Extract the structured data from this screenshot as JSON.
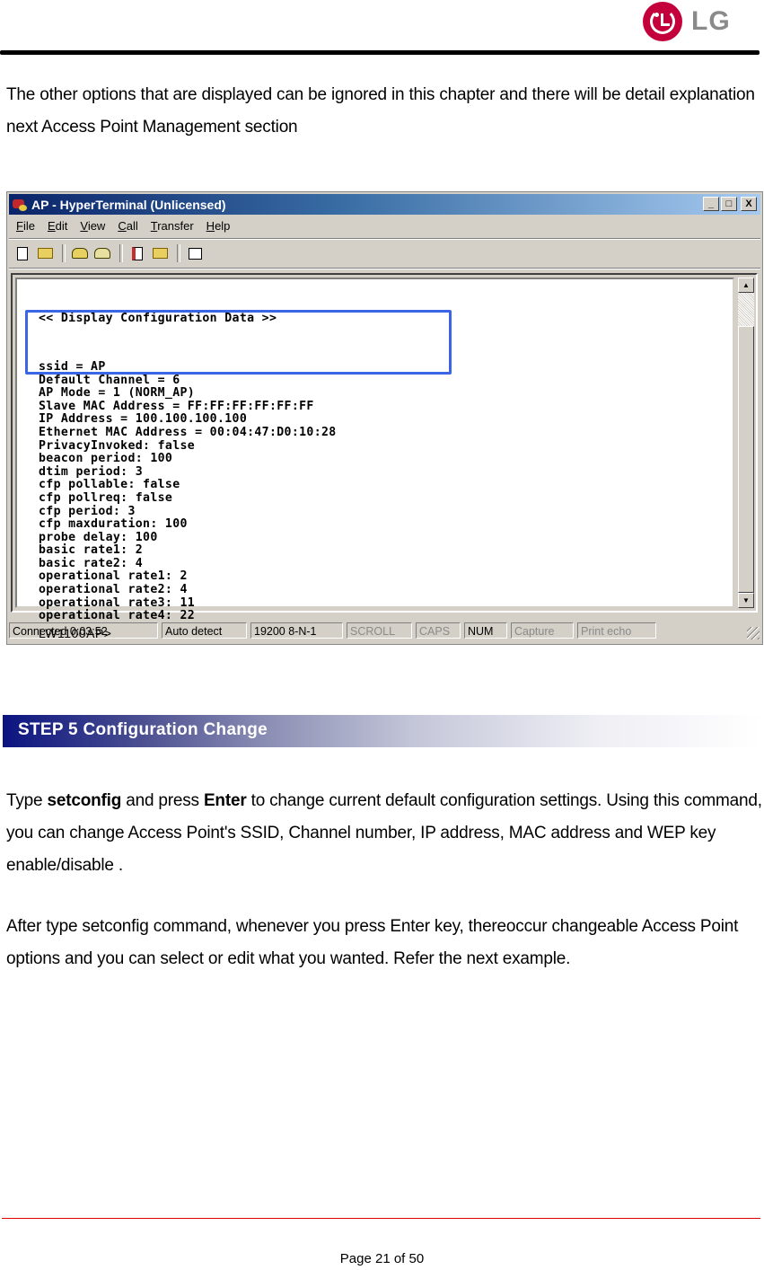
{
  "header": {
    "logo_text": "LG"
  },
  "intro": {
    "text": "The other options that are displayed can be ignored in this chapter and there will be detail explanation next Access Point Management section"
  },
  "window": {
    "title": "AP - HyperTerminal (Unlicensed)",
    "title_buttons": {
      "minimize": "_",
      "maximize": "□",
      "close": "X"
    },
    "menu": [
      {
        "key": "F",
        "rest": "ile"
      },
      {
        "key": "E",
        "rest": "dit"
      },
      {
        "key": "V",
        "rest": "iew"
      },
      {
        "key": "C",
        "rest": "all"
      },
      {
        "key": "T",
        "rest": "ransfer"
      },
      {
        "key": "H",
        "rest": "elp"
      }
    ],
    "toolbar": [
      "new-icon",
      "open-icon",
      "connect-icon",
      "disconnect-icon",
      "send-icon",
      "receive-icon",
      "properties-icon"
    ],
    "terminal": {
      "header": "<< Display Configuration Data >>",
      "lines": [
        "ssid = AP",
        "Default Channel = 6",
        "AP Mode = 1 (NORM_AP)",
        "Slave MAC Address = FF:FF:FF:FF:FF:FF",
        "IP Address = 100.100.100.100",
        "Ethernet MAC Address = 00:04:47:D0:10:28",
        "PrivacyInvoked: false",
        "beacon period: 100",
        "dtim period: 3",
        "cfp pollable: false",
        "cfp pollreq: false",
        "cfp period: 3",
        "cfp maxduration: 100",
        "probe delay: 100",
        "basic rate1: 2",
        "basic rate2: 4",
        "operational rate1: 2",
        "operational rate2: 4",
        "operational rate3: 11",
        "operational rate4: 22"
      ],
      "prompt": "LW1100AP>"
    },
    "status": {
      "connected": "Connected 0:03:52",
      "detect": "Auto detect",
      "settings": "19200 8-N-1",
      "scroll": "SCROLL",
      "caps": "CAPS",
      "num": "NUM",
      "capture": "Capture",
      "print_echo": "Print echo"
    }
  },
  "step": {
    "label": "STEP 5  Configuration Change"
  },
  "body": {
    "p2_type": "Type ",
    "p2_cmd": "setconfig",
    "p2_and": " and press ",
    "p2_key": "Enter",
    "p2_rest": " to change current default configuration settings. Using this command, you can change Access Point's SSID, Channel number, IP address, MAC address and WEP key enable/disable .",
    "p3": "After type setconfig command, whenever you press Enter key, thereoccur changeable Access Point options and you can select or edit what you wanted. Refer the next example."
  },
  "footer": {
    "page": "Page 21 of 50"
  },
  "colors": {
    "highlight_box": "#3a66e6",
    "footer_rule": "#e00000",
    "step_banner": "#0b1480",
    "lg_red": "#c4003c"
  }
}
